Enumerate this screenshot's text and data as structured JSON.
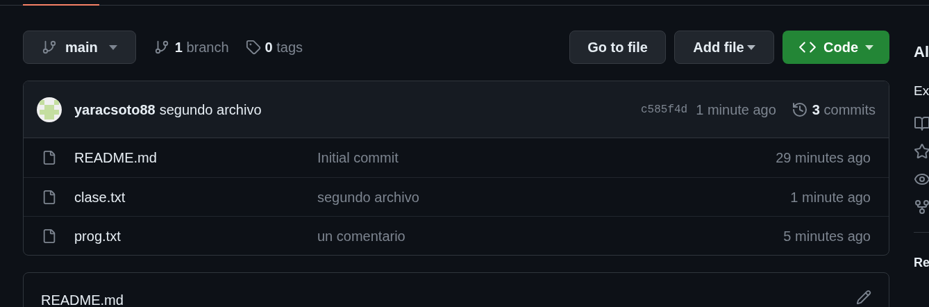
{
  "nav": {
    "selected_tab_underline": true
  },
  "branch_select": {
    "label": "main"
  },
  "branches": {
    "count": "1",
    "label": "branch"
  },
  "tags": {
    "count": "0",
    "label": "tags"
  },
  "buttons": {
    "go_to_file": "Go to file",
    "add_file": "Add file",
    "code": "Code"
  },
  "latest_commit": {
    "author": "yaracsoto88",
    "message": "segundo archivo",
    "sha": "c585f4d",
    "time": "1 minute ago",
    "commits_count": "3",
    "commits_label": "commits"
  },
  "files": [
    {
      "name": "README.md",
      "message": "Initial commit",
      "time": "29 minutes ago"
    },
    {
      "name": "clase.txt",
      "message": "segundo archivo",
      "time": "1 minute ago"
    },
    {
      "name": "prog.txt",
      "message": "un comentario",
      "time": "5 minutes ago"
    }
  ],
  "readme": {
    "title": "README.md"
  },
  "sidebar": {
    "heading": "Al",
    "description": "Ex",
    "bottom_heading": "Re"
  }
}
